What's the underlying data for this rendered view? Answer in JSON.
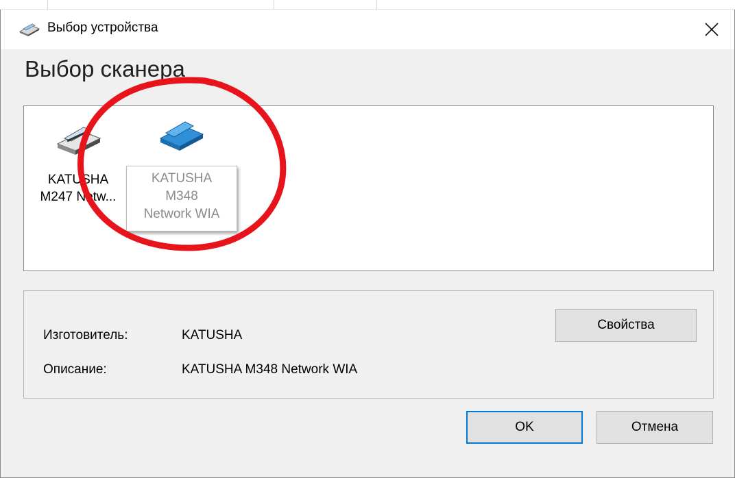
{
  "window": {
    "title": "Выбор устройства",
    "close_symbol": "✕"
  },
  "heading": "Выбор сканера",
  "devices": [
    {
      "label_line1": "KATUSHA",
      "label_line2": "M247 Netw...",
      "icon": "scanner-gray-icon",
      "selected": false
    },
    {
      "label_line1": "KATUSHA",
      "label_line2": "M348",
      "label_line3": "Network WIA",
      "icon": "scanner-blue-icon",
      "selected": true
    }
  ],
  "info": {
    "maker_label": "Изготовитель:",
    "maker_value": "KATUSHA",
    "description_label": "Описание:",
    "description_value": "KATUSHA M348 Network WIA"
  },
  "buttons": {
    "properties": "Свойства",
    "ok": "OK",
    "cancel": "Отмена"
  },
  "colors": {
    "annotation_circle": "#e8141c",
    "default_button_border": "#0078d7"
  }
}
